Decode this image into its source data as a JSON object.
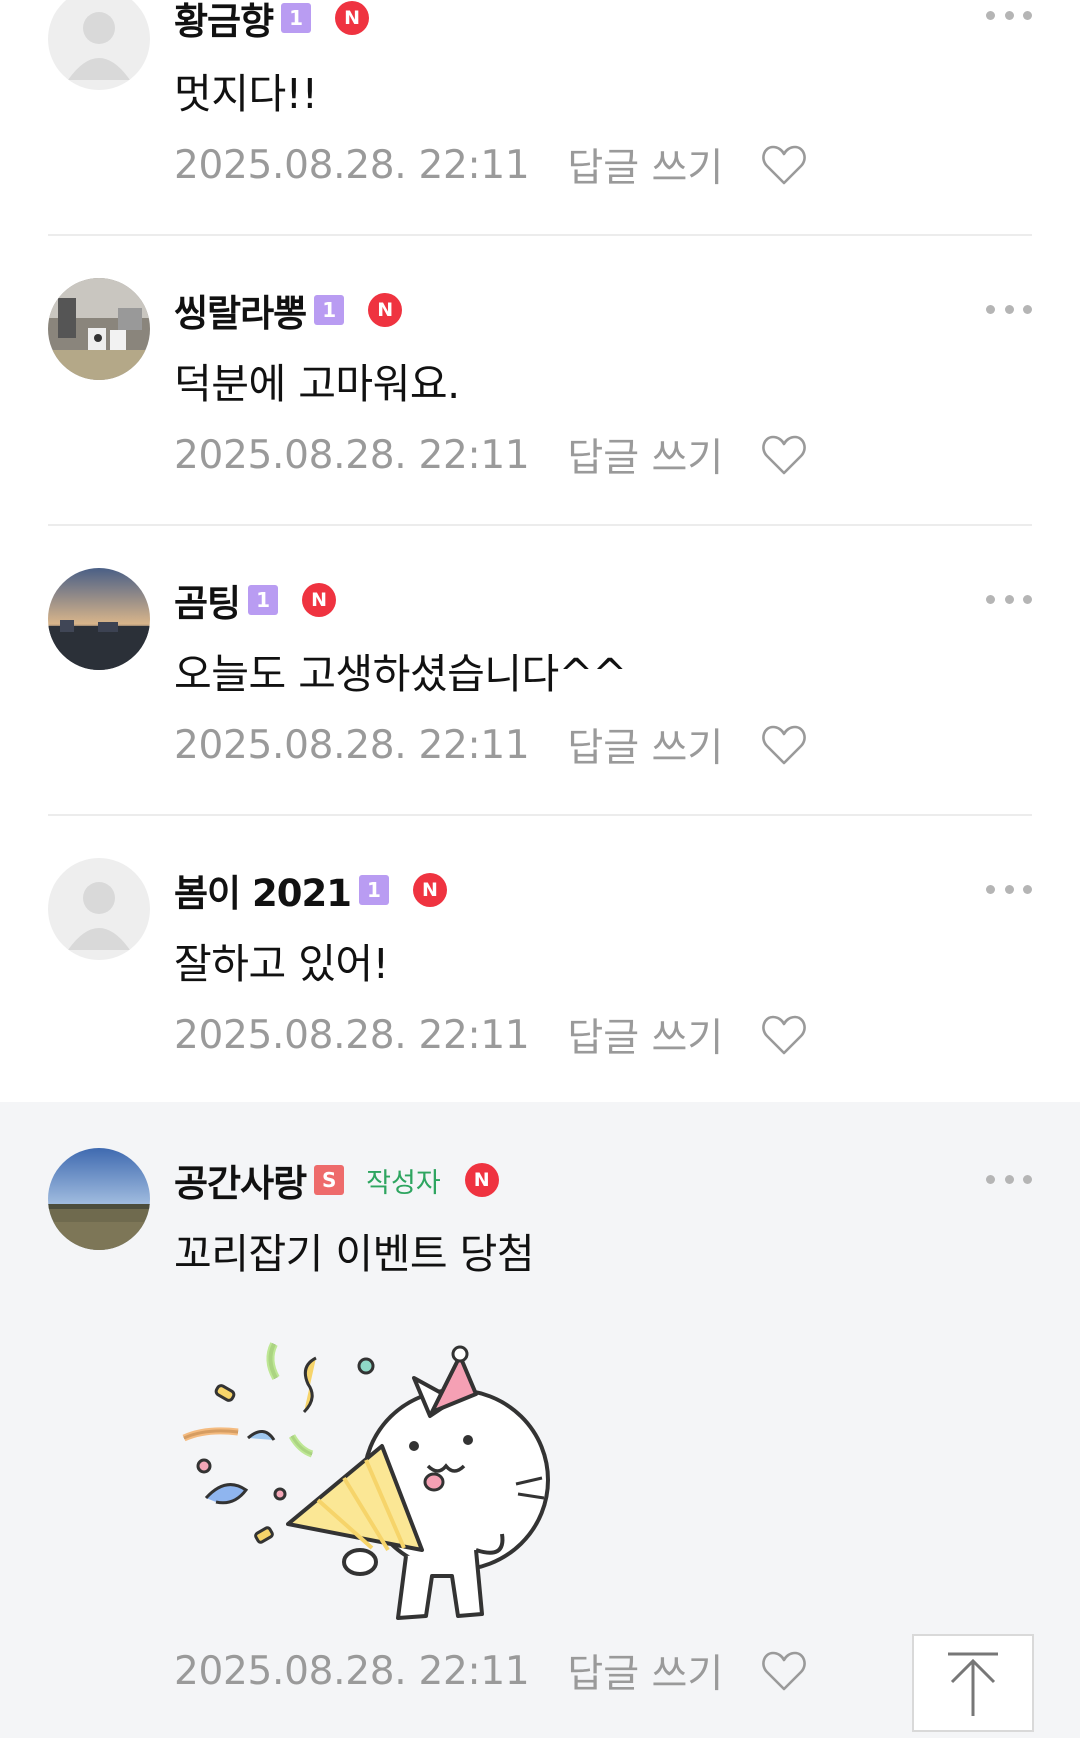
{
  "comments": [
    {
      "nickname": "황금향",
      "level": "1",
      "new": "N",
      "text": "멋지다!!",
      "date": "2025.08.28. 22:11",
      "reply": "답글 쓰기"
    },
    {
      "nickname": "씽랄라뽕",
      "level": "1",
      "new": "N",
      "text": "덕분에 고마워요.",
      "date": "2025.08.28. 22:11",
      "reply": "답글 쓰기"
    },
    {
      "nickname": "곰팅",
      "level": "1",
      "new": "N",
      "text": "오늘도 고생하셨습니다^^",
      "date": "2025.08.28. 22:11",
      "reply": "답글 쓰기"
    },
    {
      "nickname": "봄이 2021",
      "level": "1",
      "new": "N",
      "text": "잘하고 있어!",
      "date": "2025.08.28. 22:11",
      "reply": "답글 쓰기"
    },
    {
      "nickname": "공간사랑",
      "level": "S",
      "author_tag": "작성자",
      "new": "N",
      "text": "꼬리잡기 이벤트 당첨",
      "date": "2025.08.28. 22:11",
      "reply": "답글 쓰기",
      "sticker": "party-cat-sticker"
    }
  ],
  "icons": {
    "more": "more-dots-icon",
    "like": "heart-icon",
    "top": "arrow-up-to-top-icon"
  },
  "colors": {
    "new_badge": "#ef3340",
    "level_badge": "#b99cf2",
    "staff_badge": "#ee6b6b",
    "author_tag": "#2ea560",
    "meta_text": "#9a9a9a",
    "highlight_bg": "#f4f5f7"
  }
}
